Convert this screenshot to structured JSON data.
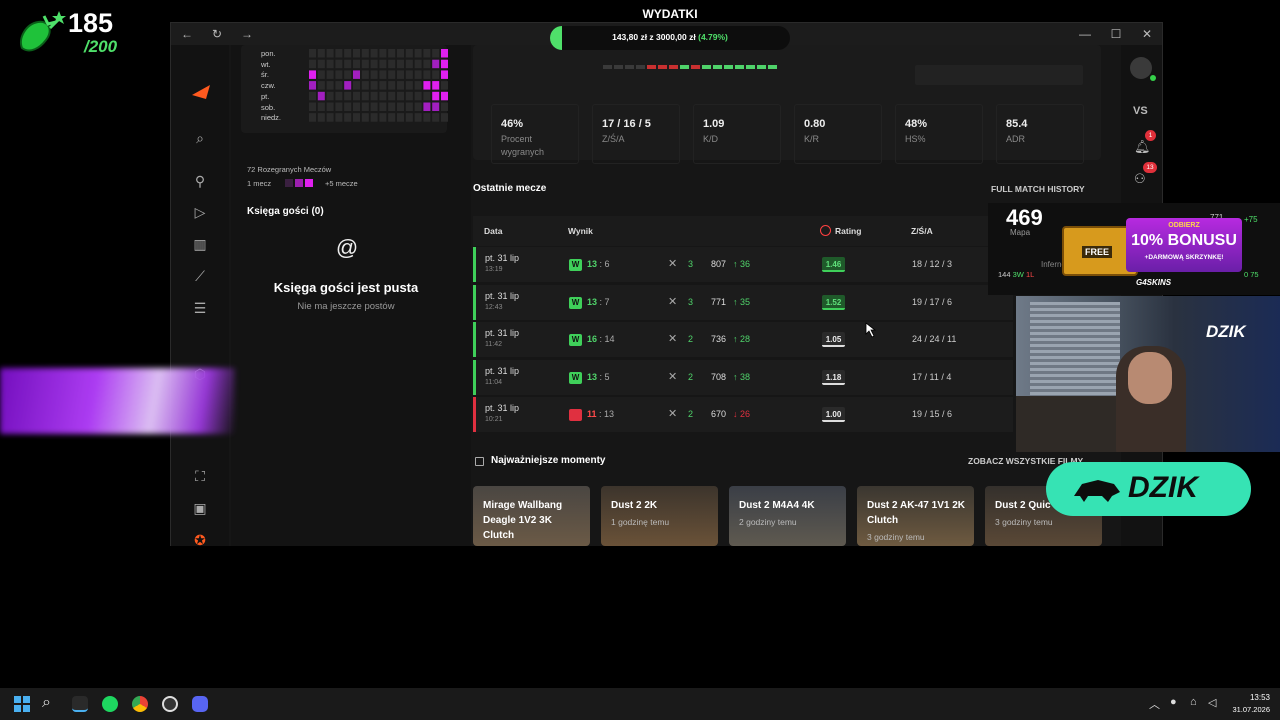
{
  "overlay": {
    "goal_current": "185",
    "goal_total": "/200",
    "expenses_title": "WYDATKI",
    "expenses_text": "143,80 zł z 3000,00 zł",
    "expenses_pct": "(4.79%)",
    "expenses_progress": 0.0479
  },
  "window": {
    "back": "←",
    "reload": "↻",
    "forward": "→",
    "minimize": "—",
    "maximize": "☐",
    "close": "✕"
  },
  "profile": {
    "days": [
      "pon.",
      "wt.",
      "śr.",
      "czw.",
      "pt.",
      "sob.",
      "niedz."
    ],
    "matches_played": "72 Rozegranych Meczów",
    "legend_min": "1 mecz",
    "legend_max": "+5 mecze",
    "guestbook_title": "Księga gości (0)",
    "guestbook_empty": "Księga gości jest pusta",
    "guestbook_sub": "Nie ma jeszcze postów"
  },
  "stats": [
    {
      "value": "46%",
      "label": "Procent wygranych"
    },
    {
      "value": "17 / 16 / 5",
      "label": "Z/Ś/A"
    },
    {
      "value": "1.09",
      "label": "K/D"
    },
    {
      "value": "0.80",
      "label": "K/R"
    },
    {
      "value": "48%",
      "label": "HS%"
    },
    {
      "value": "85.4",
      "label": "ADR"
    }
  ],
  "recent": {
    "title": "Ostatnie mecze",
    "history_link": "FULL MATCH HISTORY",
    "col_date": "Data",
    "col_result": "Wynik",
    "col_rating": "Rating",
    "col_kda": "Z/Ś/A",
    "matches": [
      {
        "date": "pt. 31 lip",
        "time": "13:19",
        "result": "W",
        "score_own": "13",
        "score_opp": "6",
        "kills": "3",
        "elo": "807",
        "delta": "36",
        "rating": "1.46",
        "kda": "18 / 12 / 3"
      },
      {
        "date": "pt. 31 lip",
        "time": "12:43",
        "result": "W",
        "score_own": "13",
        "score_opp": "7",
        "kills": "3",
        "elo": "771",
        "delta": "35",
        "rating": "1.52",
        "kda": "19 / 17 / 6"
      },
      {
        "date": "pt. 31 lip",
        "time": "11:42",
        "result": "W",
        "score_own": "16",
        "score_opp": "14",
        "kills": "2",
        "elo": "736",
        "delta": "28",
        "rating": "1.05",
        "kda": "24 / 24 / 11"
      },
      {
        "date": "pt. 31 lip",
        "time": "11:04",
        "result": "W",
        "score_own": "13",
        "score_opp": "5",
        "kills": "2",
        "elo": "708",
        "delta": "38",
        "rating": "1.18",
        "kda": "17 / 11 / 4"
      },
      {
        "date": "pt. 31 lip",
        "time": "10:21",
        "result": "L",
        "score_own": "11",
        "score_opp": "13",
        "kills": "2",
        "elo": "670",
        "delta": "26",
        "rating": "1.00",
        "kda": "19 / 15 / 6"
      }
    ]
  },
  "highlights": {
    "title": "Najważniejsze momenty",
    "see_all": "ZOBACZ WSZYSTKIE FILMY",
    "videos": [
      {
        "title": "Mirage Wallbang Deagle 1V2 3K Clutch",
        "sub": ""
      },
      {
        "title": "Dust 2 2K",
        "sub": "1 godzinę temu"
      },
      {
        "title": "Dust 2 M4A4 4K",
        "sub": "2 godziny temu"
      },
      {
        "title": "Dust 2 AK-47 1V1 2K Clutch",
        "sub": "3 godziny temu"
      },
      {
        "title": "Dust 2 Quic 4K",
        "sub": "3 godziny temu"
      }
    ]
  },
  "right_rail": {
    "vs": "VS",
    "notif_count": "1",
    "friends_count": "13"
  },
  "stream_overlay": {
    "elo": "469",
    "map_label": "Mapa",
    "map_name": "Inferno",
    "elo_small": "771",
    "delta_small": "+75",
    "record_w": "3W",
    "record_l": "1L",
    "record_n": "144",
    "mini_val": "0 75",
    "promo_top": "ODBIERZ",
    "promo_main": "10% BONUSU",
    "promo_sub": "+DARMOWĄ SKRZYNKĘ!",
    "promo_free": "FREE",
    "promo_brand": "G4SKINS",
    "brand": "DZIK",
    "brand_small": "DZIK"
  },
  "taskbar": {
    "time": "13:53",
    "date": "31.07.2026"
  }
}
